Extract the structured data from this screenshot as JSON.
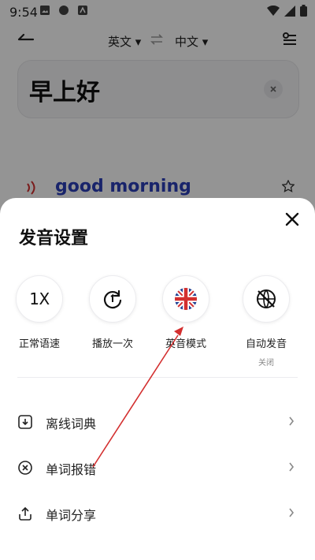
{
  "status": {
    "time": "9:54"
  },
  "topbar": {
    "source_lang": "英文 ▾",
    "target_lang": "中文 ▾"
  },
  "input": {
    "text": "早上好"
  },
  "result": {
    "word": "good morning"
  },
  "sheet": {
    "title": "发音设置",
    "options": [
      {
        "label": "正常语速",
        "icon": "1X",
        "sub": ""
      },
      {
        "label": "播放一次",
        "icon": "repeat-once-icon",
        "sub": ""
      },
      {
        "label": "英音模式",
        "icon": "uk-flag-icon",
        "sub": ""
      },
      {
        "label": "自动发音",
        "icon": "globe-off-icon",
        "sub": "关闭"
      }
    ],
    "rows": [
      {
        "label": "离线词典",
        "icon": "download-icon"
      },
      {
        "label": "单词报错",
        "icon": "error-circle-icon"
      },
      {
        "label": "单词分享",
        "icon": "share-icon"
      }
    ]
  },
  "colors": {
    "accent_text": "#2b3fb8",
    "speaker": "#d32f2f",
    "annotation": "#d32f2f"
  }
}
